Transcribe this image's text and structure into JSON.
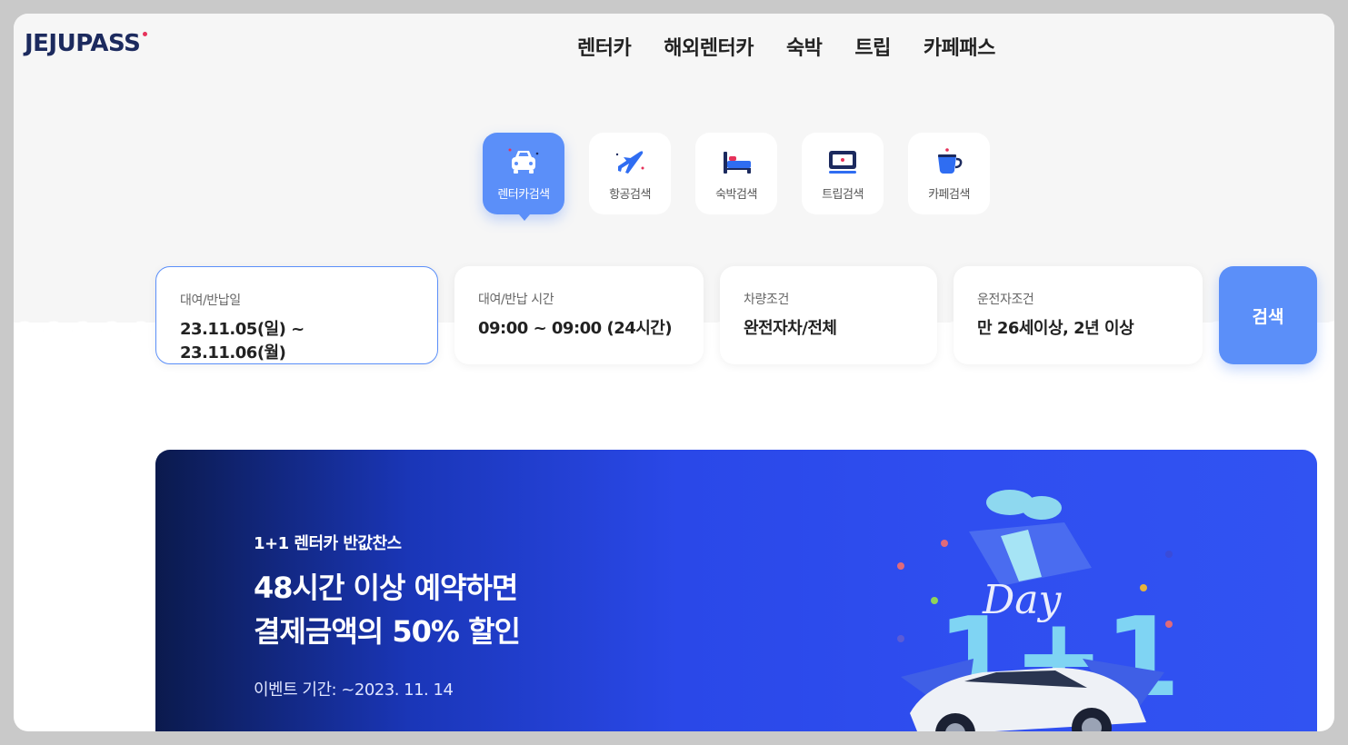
{
  "brand": {
    "logo_text": "JEJUPASS",
    "accent": "#e6325a",
    "primary": "#5b8ff9"
  },
  "nav": [
    {
      "label": "렌터카"
    },
    {
      "label": "해외렌터카"
    },
    {
      "label": "숙박"
    },
    {
      "label": "트립"
    },
    {
      "label": "카페패스"
    }
  ],
  "categories": [
    {
      "label": "렌터카검색",
      "icon": "car-icon",
      "active": true
    },
    {
      "label": "항공검색",
      "icon": "airplane-icon",
      "active": false
    },
    {
      "label": "숙박검색",
      "icon": "bed-icon",
      "active": false
    },
    {
      "label": "트립검색",
      "icon": "ticket-icon",
      "active": false
    },
    {
      "label": "카페검색",
      "icon": "coffee-cup-icon",
      "active": false
    }
  ],
  "search": {
    "dates": {
      "label": "대여/반납일",
      "value": "23.11.05(일) ~ 23.11.06(월)"
    },
    "times": {
      "label": "대여/반납 시간",
      "value": "09:00 ~ 09:00 (24시간)"
    },
    "vehicle": {
      "label": "차량조건",
      "value": "완전자차/전체"
    },
    "driver": {
      "label": "운전자조건",
      "value": "만 26세이상, 2년 이상"
    },
    "button_label": "검색"
  },
  "banner": {
    "subtitle": "1+1 렌터카 반값찬스",
    "title_line1": "48시간 이상 예약하면",
    "title_line2": "결제금액의 50% 할인",
    "period": "이벤트 기간: ~2023. 11. 14",
    "art_text": "1+1",
    "art_script": "Day"
  }
}
